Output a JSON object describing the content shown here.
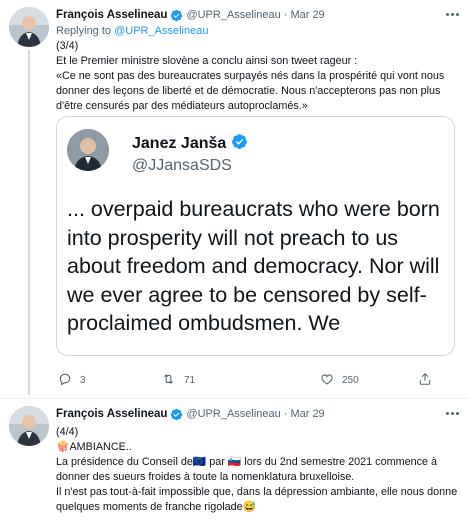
{
  "tweet1": {
    "author_name": "François Asselineau",
    "handle": "@UPR_Asselineau",
    "separator": "·",
    "date": "Mar 29",
    "replying_prefix": "Replying to",
    "replying_handle": "@UPR_Asselineau",
    "lines": [
      "(3/4)",
      "Et le Premier ministre slovène a conclu ainsi son tweet rageur :",
      "«Ce ne sont pas des bureaucrates surpayés nés dans la prospérité qui vont nous donner des leçons de liberté et de démocratie. Nous n'accepterons pas non plus d'être censurés par des médiateurs autoproclamés.»"
    ],
    "media": {
      "name": "Janez Janša",
      "handle": "@JJansaSDS",
      "text": "... overpaid bureaucrats who were born into prosperity will not preach to us about freedom and democracy.  Nor will we ever agree to be censored by self-proclaimed ombudsmen.  We"
    },
    "actions": {
      "reply_count": "3",
      "retweet_count": "71",
      "like_count": "250"
    }
  },
  "tweet2": {
    "author_name": "François Asselineau",
    "handle": "@UPR_Asselineau",
    "separator": "·",
    "date": "Mar 29",
    "lines": [
      "(4/4)",
      "🍿AMBIANCE..",
      "La présidence du Conseil de🇪🇺 par 🇸🇮 lors du 2nd semestre 2021 commence à donner des sueurs froides à toute la nomenklatura bruxelloise.",
      "Il n'est pas tout-à-fait impossible que, dans la dépression ambiante, elle nous donne quelques moments de franche rigolade😅"
    ]
  },
  "colors": {
    "accent": "#1d9bf0",
    "secondary_text": "#536471",
    "border": "#cfd9de"
  },
  "icons": [
    "verified-badge-icon",
    "more-icon",
    "reply-icon",
    "retweet-icon",
    "like-icon",
    "share-icon"
  ]
}
